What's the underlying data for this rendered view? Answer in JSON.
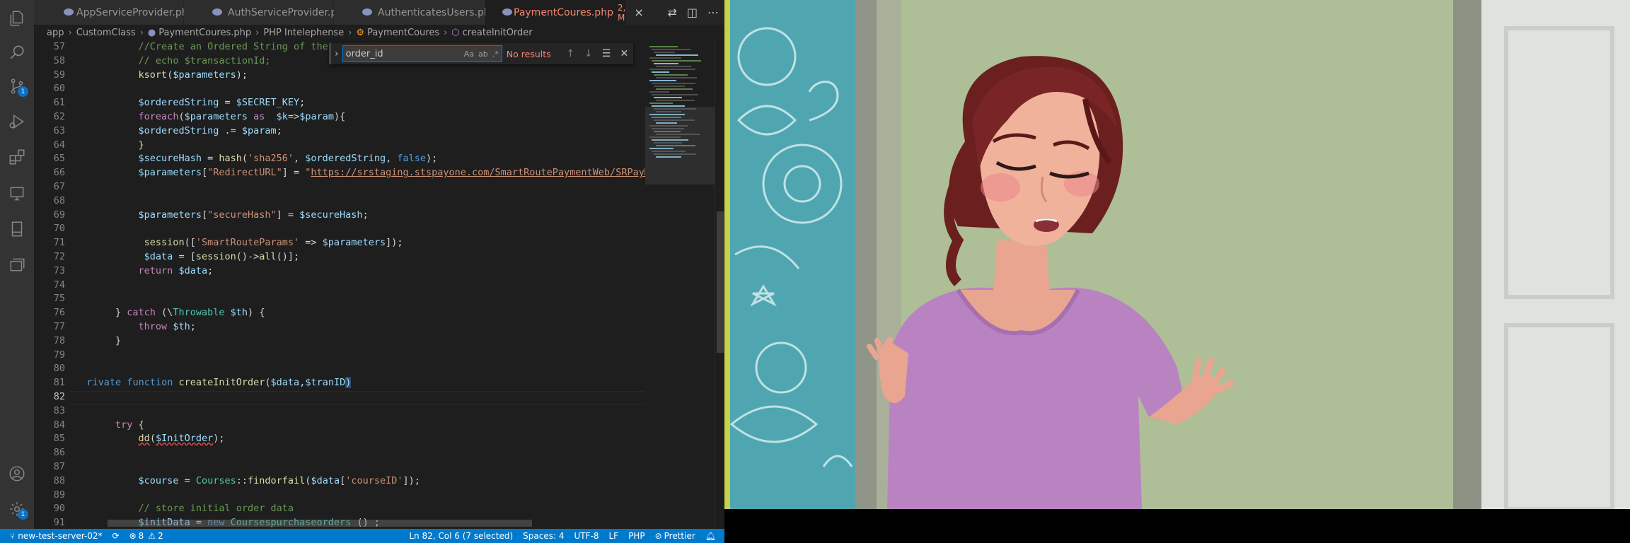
{
  "tabs": [
    {
      "label": "AppServiceProvider.php",
      "active": false
    },
    {
      "label": "AuthServiceProvider.php",
      "active": false
    },
    {
      "label": "AuthenticatesUsers.php",
      "active": false
    },
    {
      "label": "PaymentCoures.php",
      "active": true,
      "status": "2, M"
    }
  ],
  "breadcrumb": {
    "items": [
      "app",
      "CustomClass",
      "PaymentCoures.php",
      "PHP Intelephense",
      "PaymentCoures",
      "createInitOrder"
    ]
  },
  "find": {
    "value": "order_id",
    "result": "No results",
    "opt_case": "Aa",
    "opt_word": "ab",
    "opt_regex": ".*"
  },
  "line_numbers": [
    "57",
    "58",
    "59",
    "60",
    "61",
    "62",
    "63",
    "64",
    "65",
    "66",
    "67",
    "68",
    "69",
    "70",
    "71",
    "72",
    "73",
    "74",
    "75",
    "76",
    "77",
    "78",
    "79",
    "80",
    "81",
    "82",
    "83",
    "84",
    "85",
    "86",
    "87",
    "88",
    "89",
    "90",
    "91"
  ],
  "current_line": "82",
  "status_bar": {
    "branch": "new-test-server-02*",
    "errors": "8",
    "warnings": "2",
    "cursor": "Ln 82, Col 6 (7 selected)",
    "spaces": "Spaces: 4",
    "encoding": "UTF-8",
    "eol": "LF",
    "language": "PHP",
    "formatter": "Prettier"
  },
  "activity_bar": {
    "scm_badge": "1",
    "settings_badge": "1"
  },
  "colors": {
    "accent": "#007acc",
    "editor_bg": "#1e1e1e",
    "tab_active_text": "#f48771"
  }
}
